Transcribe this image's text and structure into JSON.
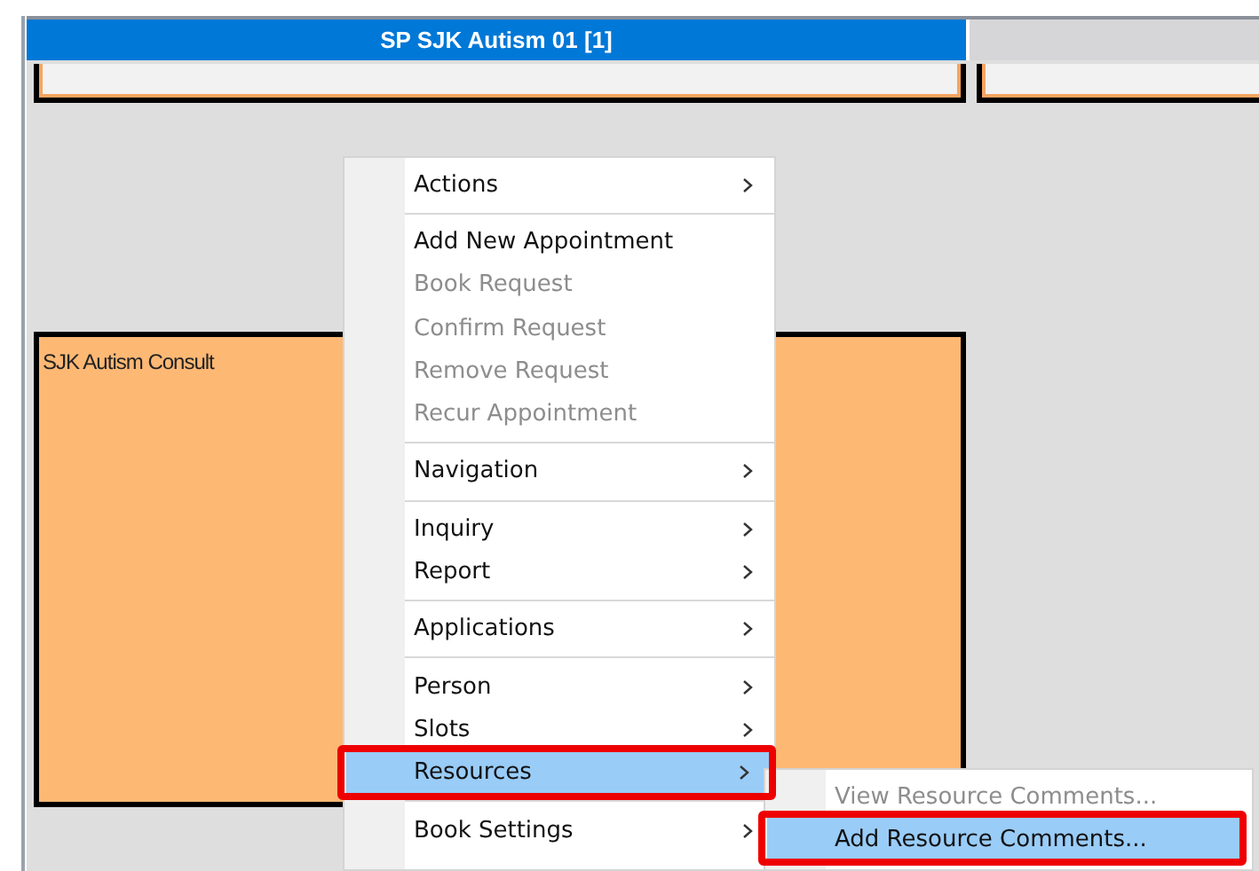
{
  "schedule": {
    "column_header": "SP SJK Autism 01 [1]",
    "appointments": [
      {
        "kind": "top"
      },
      {
        "kind": "top-right"
      },
      {
        "kind": "main",
        "label": "SJK Autism Consult"
      }
    ]
  },
  "context_menu": {
    "items": [
      {
        "kind": "item",
        "label": "Actions",
        "submenu": true,
        "disabled": false,
        "selected": false,
        "highlighted": false
      },
      {
        "kind": "separator"
      },
      {
        "kind": "item",
        "label": "Add New Appointment",
        "submenu": false,
        "disabled": false,
        "selected": false,
        "highlighted": false
      },
      {
        "kind": "item",
        "label": "Book Request",
        "submenu": false,
        "disabled": true,
        "selected": false,
        "highlighted": false
      },
      {
        "kind": "item",
        "label": "Confirm Request",
        "submenu": false,
        "disabled": true,
        "selected": false,
        "highlighted": false
      },
      {
        "kind": "item",
        "label": "Remove Request",
        "submenu": false,
        "disabled": true,
        "selected": false,
        "highlighted": false
      },
      {
        "kind": "item",
        "label": "Recur Appointment",
        "submenu": false,
        "disabled": true,
        "selected": false,
        "highlighted": false
      },
      {
        "kind": "separator"
      },
      {
        "kind": "item",
        "label": "Navigation",
        "submenu": true,
        "disabled": false,
        "selected": false,
        "highlighted": false
      },
      {
        "kind": "separator"
      },
      {
        "kind": "item",
        "label": "Inquiry",
        "submenu": true,
        "disabled": false,
        "selected": false,
        "highlighted": false
      },
      {
        "kind": "item",
        "label": "Report",
        "submenu": true,
        "disabled": false,
        "selected": false,
        "highlighted": false
      },
      {
        "kind": "separator"
      },
      {
        "kind": "item",
        "label": "Applications",
        "submenu": true,
        "disabled": false,
        "selected": false,
        "highlighted": false
      },
      {
        "kind": "separator"
      },
      {
        "kind": "item",
        "label": "Person",
        "submenu": true,
        "disabled": false,
        "selected": false,
        "highlighted": false
      },
      {
        "kind": "item",
        "label": "Slots",
        "submenu": true,
        "disabled": false,
        "selected": false,
        "highlighted": false
      },
      {
        "kind": "item",
        "label": "Resources",
        "submenu": true,
        "disabled": false,
        "selected": true,
        "highlighted": true
      },
      {
        "kind": "separator"
      },
      {
        "kind": "item",
        "label": "Book Settings",
        "submenu": true,
        "disabled": false,
        "selected": false,
        "highlighted": false
      }
    ]
  },
  "submenu": {
    "items": [
      {
        "kind": "item",
        "label": "View Resource Comments...",
        "submenu": false,
        "disabled": true,
        "selected": false,
        "highlighted": false
      },
      {
        "kind": "item",
        "label": "Add Resource Comments...",
        "submenu": false,
        "disabled": false,
        "selected": true,
        "highlighted": true
      }
    ]
  }
}
